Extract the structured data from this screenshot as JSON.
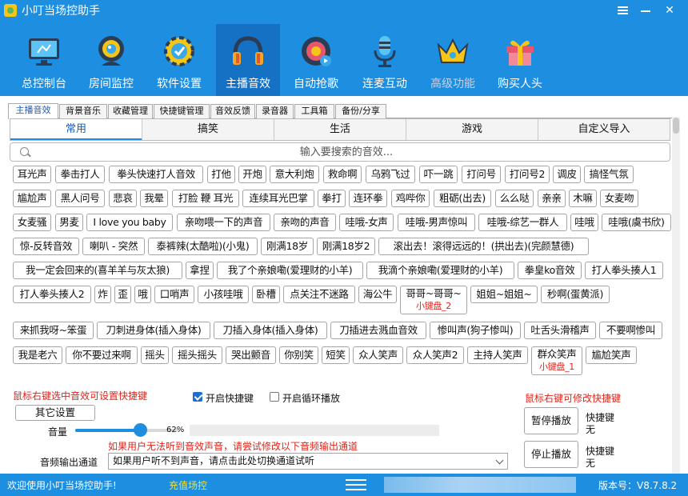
{
  "window": {
    "title": "小叮当场控助手"
  },
  "nav": [
    {
      "label": "总控制台",
      "icon": "monitor-icon"
    },
    {
      "label": "房间监控",
      "icon": "webcam-icon"
    },
    {
      "label": "软件设置",
      "icon": "settings-gear-icon"
    },
    {
      "label": "主播音效",
      "icon": "headphones-icon",
      "active": true
    },
    {
      "label": "自动抢歌",
      "icon": "music-disc-icon"
    },
    {
      "label": "连麦互动",
      "icon": "microphone-icon"
    },
    {
      "label": "高级功能",
      "icon": "crown-icon"
    },
    {
      "label": "购买人头",
      "icon": "gift-icon"
    }
  ],
  "subtabs": [
    "主播音效",
    "背景音乐",
    "收藏管理",
    "快捷键管理",
    "音效反馈",
    "录音器",
    "工具箱",
    "备份/分享"
  ],
  "categories": [
    "常用",
    "搞笑",
    "生活",
    "游戏",
    "自定义导入"
  ],
  "search": {
    "placeholder": "输入要搜索的音效..."
  },
  "sounds": [
    {
      "label": "耳光声"
    },
    {
      "label": "拳击打人"
    },
    {
      "label": "拳头快速打人音效"
    },
    {
      "label": "打他"
    },
    {
      "label": "开炮"
    },
    {
      "label": "意大利炮"
    },
    {
      "label": "救命啊"
    },
    {
      "label": "乌鸦飞过"
    },
    {
      "label": "吓一跳"
    },
    {
      "label": "打问号"
    },
    {
      "label": "打问号2"
    },
    {
      "label": "调皮"
    },
    {
      "label": "搞怪气氛"
    },
    {
      "label": "尴尬声"
    },
    {
      "label": "黑人问号"
    },
    {
      "label": "悲哀"
    },
    {
      "label": "我晕"
    },
    {
      "label": "打脸 鞭 耳光"
    },
    {
      "label": "连续耳光巴掌"
    },
    {
      "label": "拳打"
    },
    {
      "label": "连环拳"
    },
    {
      "label": "鸡哔你"
    },
    {
      "label": "粗砺(出去)"
    },
    {
      "label": "么么哒"
    },
    {
      "label": "亲亲"
    },
    {
      "label": "木嘛"
    },
    {
      "label": "女麦吻"
    },
    {
      "label": "女麦骚"
    },
    {
      "label": "男麦"
    },
    {
      "label": "I love you baby"
    },
    {
      "label": "亲吻喂一下的声音"
    },
    {
      "label": "亲吻的声音"
    },
    {
      "label": "哇哦-女声"
    },
    {
      "label": "哇哦-男声惊叫"
    },
    {
      "label": "哇哦-综艺一群人"
    },
    {
      "label": "哇哦"
    },
    {
      "label": "哇哦(虞书欣)"
    },
    {
      "label": "惊-反转音效"
    },
    {
      "label": "喇叭 - 突然"
    },
    {
      "label": "泰裤辣(太酷啦)(小鬼)"
    },
    {
      "label": "刚满18岁"
    },
    {
      "label": "刚满18岁2"
    },
    {
      "label": "滚出去！滚得远远的！(拱出去)(完颜慧德)"
    },
    {
      "label": "我一定会回来的(喜羊羊与灰太狼)"
    },
    {
      "label": "拿捏"
    },
    {
      "label": "我了个亲娘嘞(爱理财的小羊)"
    },
    {
      "label": "我滴个亲娘嘞(爱理财的小羊)"
    },
    {
      "label": "拳皇ko音效"
    },
    {
      "label": "打人拳头揍人1"
    },
    {
      "label": "打人拳头揍人2"
    },
    {
      "label": "炸"
    },
    {
      "label": "歪"
    },
    {
      "label": "哦"
    },
    {
      "label": "口哨声"
    },
    {
      "label": "小孩哇哦"
    },
    {
      "label": "卧槽"
    },
    {
      "label": "点关注不迷路"
    },
    {
      "label": "海公牛"
    },
    {
      "label": "哥哥~哥哥~",
      "hotkey": "小键盘_2"
    },
    {
      "label": "姐姐~姐姐~"
    },
    {
      "label": "秒啊(蛋黄派)"
    },
    {
      "label": "来抓我呀~笨蛋"
    },
    {
      "label": "刀刺进身体(插入身体)"
    },
    {
      "label": "刀插入身体(插入身体)"
    },
    {
      "label": "刀插进去溅血音效"
    },
    {
      "label": "惨叫声(狗子惨叫)"
    },
    {
      "label": "吐舌头滑稽声"
    },
    {
      "label": "不要啊惨叫"
    },
    {
      "label": "我是老六"
    },
    {
      "label": "你不要过来啊"
    },
    {
      "label": "摇头"
    },
    {
      "label": "摇头摇头"
    },
    {
      "label": "哭出颤音"
    },
    {
      "label": "你别笑"
    },
    {
      "label": "短笑"
    },
    {
      "label": "众人笑声"
    },
    {
      "label": "众人笑声2"
    },
    {
      "label": "主持人笑声"
    },
    {
      "label": "群众笑声",
      "hotkey": "小键盘_1"
    },
    {
      "label": "尴尬笑声"
    }
  ],
  "controls": {
    "hint_left": "鼠标右键选中音效可设置快捷键",
    "hint_right": "鼠标右键可修改快捷键",
    "enable_hotkey": {
      "label": "开启快捷键",
      "checked": true
    },
    "loop_play": {
      "label": "开启循环播放",
      "checked": false
    },
    "other_settings": "其它设置",
    "volume_label": "音量",
    "volume_value": 62,
    "volume_text": "62%",
    "warning": "如果用户无法听到音效声音，请尝试修改以下音频输出通道",
    "output_label": "音频输出通道",
    "output_value": "如果用户听不到声音，请点击此处切换通道试听",
    "pause_button": "暂停播放",
    "stop_button": "停止播放",
    "hotkey_label": "快捷键",
    "pause_hotkey": "无",
    "stop_hotkey": "无"
  },
  "status": {
    "welcome": "欢迎使用小叮当场控助手!",
    "recharge": "充值场控",
    "version": "版本号：V8.7.8.2"
  },
  "colors": {
    "primary": "#1e8fe0",
    "active_nav": "#1571c4",
    "warning": "#e0241b",
    "link": "#f7e12a"
  }
}
